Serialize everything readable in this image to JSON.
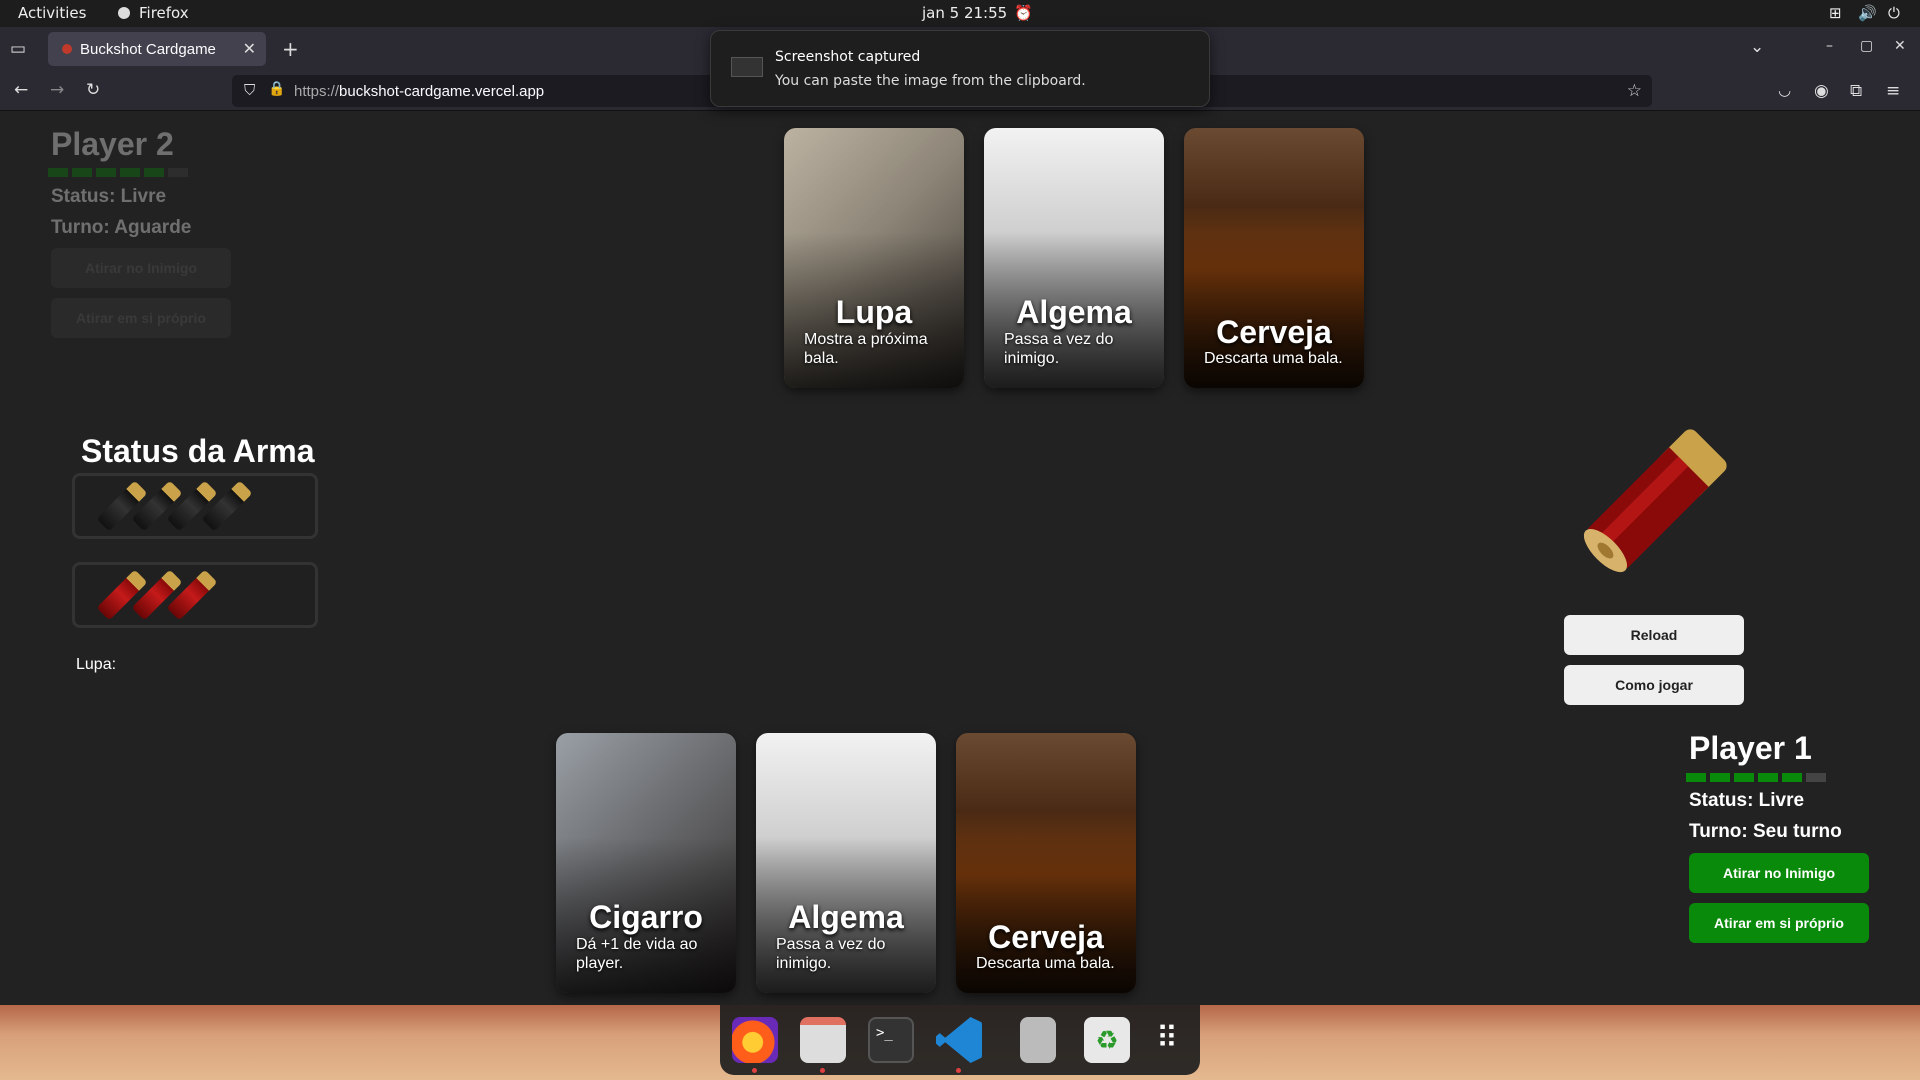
{
  "system": {
    "activities": "Activities",
    "app": "Firefox",
    "clock": "jan 5  21:55"
  },
  "browser": {
    "tab_title": "Buckshot Cardgame",
    "url_prefix": "https://",
    "url_host": "buckshot-cardgame.vercel.app"
  },
  "toast": {
    "title": "Screenshot captured",
    "body": "You can paste the image from the clipboard."
  },
  "player2": {
    "name": "Player 2",
    "hp_filled": 5,
    "hp_total": 6,
    "status": "Status: Livre",
    "turn": "Turno: Aguarde",
    "shoot_enemy": "Atirar no Inimigo",
    "shoot_self": "Atirar em si próprio"
  },
  "player1": {
    "name": "Player 1",
    "hp_filled": 5,
    "hp_total": 6,
    "status": "Status: Livre",
    "turn": "Turno: Seu turno",
    "shoot_enemy": "Atirar no Inimigo",
    "shoot_self": "Atirar em si próprio"
  },
  "gun": {
    "title": "Status da Arma",
    "blank_shells": 4,
    "live_shells": 3,
    "lupa_label": "Lupa:"
  },
  "controls": {
    "reload": "Reload",
    "how_to": "Como jogar"
  },
  "top_cards": [
    {
      "name": "Lupa",
      "desc": "Mostra a próxima bala.",
      "art": "magnifier"
    },
    {
      "name": "Algema",
      "desc": "Passa a vez do inimigo.",
      "art": "handcuffs"
    },
    {
      "name": "Cerveja",
      "desc": "Descarta uma bala.",
      "art": "beer"
    }
  ],
  "bottom_cards": [
    {
      "name": "Cigarro",
      "desc": "Dá +1 de vida ao player.",
      "art": "cigarette"
    },
    {
      "name": "Algema",
      "desc": "Passa a vez do inimigo.",
      "art": "handcuffs"
    },
    {
      "name": "Cerveja",
      "desc": "Descarta uma bala.",
      "art": "beer"
    }
  ],
  "colors": {
    "health": "#0a8a0a",
    "live_shell": "#c41a1a",
    "blank_shell": "#222222"
  }
}
